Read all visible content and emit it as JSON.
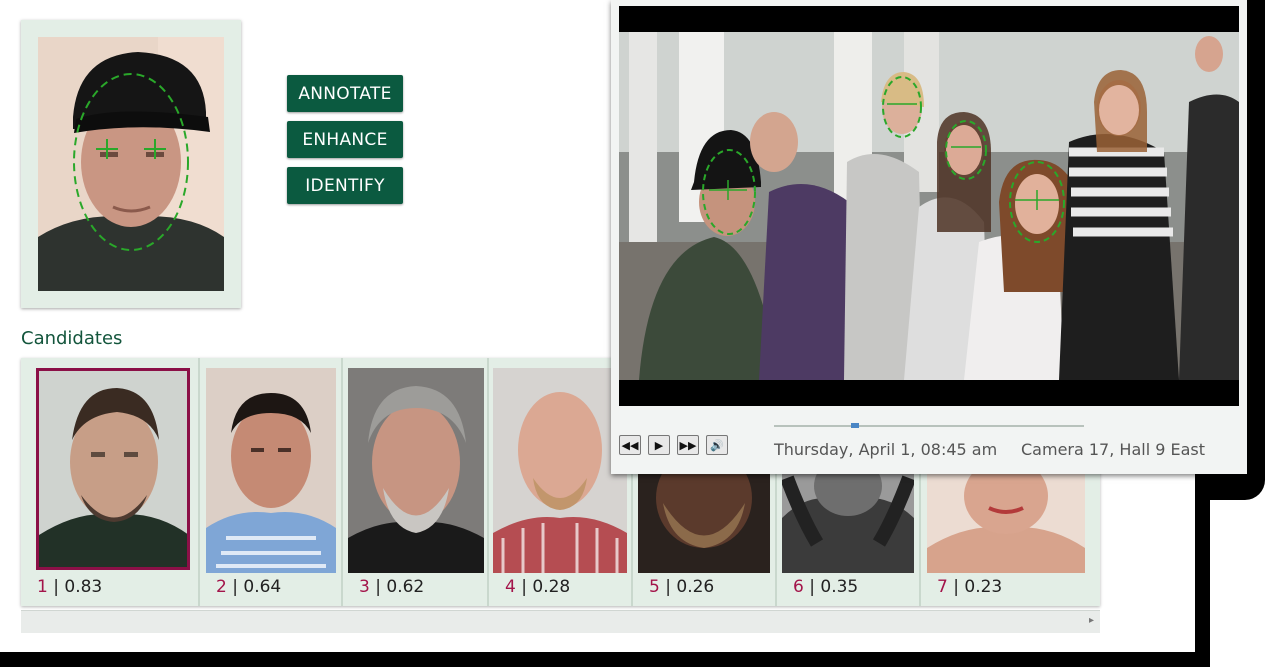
{
  "actions": {
    "annotate": "ANNOTATE",
    "enhance": "ENHANCE",
    "identify": "IDENTIFY"
  },
  "candidates_title": "Candidates",
  "candidates": [
    {
      "rank": "1",
      "score": "0.83",
      "selected": true
    },
    {
      "rank": "2",
      "score": "0.64"
    },
    {
      "rank": "3",
      "score": "0.62"
    },
    {
      "rank": "4",
      "score": "0.28"
    },
    {
      "rank": "5",
      "score": "0.26"
    },
    {
      "rank": "6",
      "score": "0.35"
    },
    {
      "rank": "7",
      "score": "0.23"
    }
  ],
  "player": {
    "date_time": "Thursday, April 1, 08:45 am",
    "camera": "Camera 17, Hall 9 East",
    "progress_fraction": 0.26
  },
  "colors": {
    "accent": "#0b5a40",
    "rank": "#a3144a",
    "panel": "#e3eee6",
    "face_marker": "#2aa82a"
  }
}
